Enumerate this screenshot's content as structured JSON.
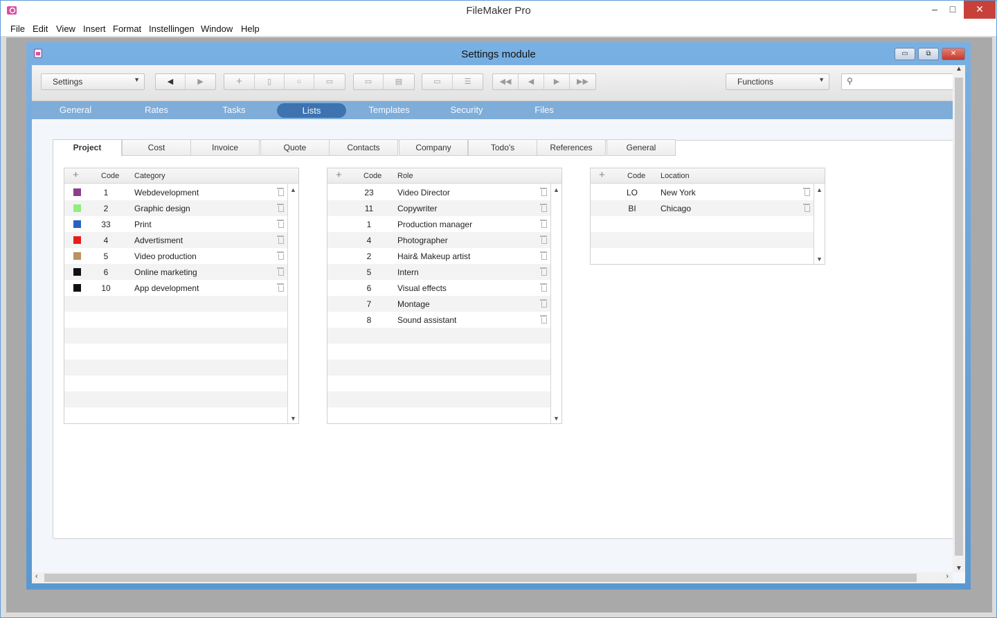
{
  "app": {
    "title": "FileMaker Pro",
    "menu": [
      "File",
      "Edit",
      "View",
      "Insert",
      "Format",
      "Instellingen",
      "Window",
      "Help"
    ],
    "minimize": "–",
    "maximize": "□",
    "close": "✕"
  },
  "window": {
    "title": "Settings module",
    "minimize": "▭",
    "restore": "⧉",
    "close": "✕"
  },
  "toolbar": {
    "layout_select": "Settings",
    "functions_select": "Functions",
    "search_placeholder": "",
    "nav_back": "◀",
    "nav_forward": "▶",
    "new_record": "+",
    "delete_record": "🗑",
    "find": "🔍",
    "first": "⏮",
    "prev": "◀",
    "next": "▶",
    "last": "⏭"
  },
  "main_tabs": [
    "General",
    "Rates",
    "Tasks",
    "Lists",
    "Templates",
    "Security",
    "Files"
  ],
  "active_main_tab": "Lists",
  "sub_tabs": [
    "Project",
    "Cost",
    "Invoice",
    "Quote",
    "Contacts",
    "Company",
    "Todo's",
    "References",
    "General"
  ],
  "active_sub_tab": "Project",
  "categories": {
    "headers": {
      "add": "+",
      "code": "Code",
      "name": "Category"
    },
    "rows": [
      {
        "code": "1",
        "name": "Webdevelopment",
        "color": "#8e3d8c"
      },
      {
        "code": "2",
        "name": "Graphic design",
        "color": "#8ff07a"
      },
      {
        "code": "33",
        "name": "Print",
        "color": "#2a5fc4"
      },
      {
        "code": "4",
        "name": "Advertisment",
        "color": "#e81c1c"
      },
      {
        "code": "5",
        "name": "Video production",
        "color": "#b89462"
      },
      {
        "code": "6",
        "name": "Online marketing",
        "color": "#111111"
      },
      {
        "code": "10",
        "name": "App development",
        "color": "#111111"
      }
    ]
  },
  "roles": {
    "headers": {
      "add": "+",
      "code": "Code",
      "name": "Role"
    },
    "rows": [
      {
        "code": "23",
        "name": "Video Director"
      },
      {
        "code": "11",
        "name": "Copywriter"
      },
      {
        "code": "1",
        "name": "Production manager"
      },
      {
        "code": "4",
        "name": "Photographer"
      },
      {
        "code": "2",
        "name": "Hair& Makeup artist"
      },
      {
        "code": "5",
        "name": "Intern"
      },
      {
        "code": "6",
        "name": "Visual effects"
      },
      {
        "code": "7",
        "name": "Montage"
      },
      {
        "code": "8",
        "name": "Sound assistant"
      }
    ]
  },
  "locations": {
    "headers": {
      "add": "+",
      "code": "Code",
      "name": "Location"
    },
    "rows": [
      {
        "code": "LO",
        "name": "New York"
      },
      {
        "code": "BI",
        "name": "Chicago"
      }
    ]
  }
}
